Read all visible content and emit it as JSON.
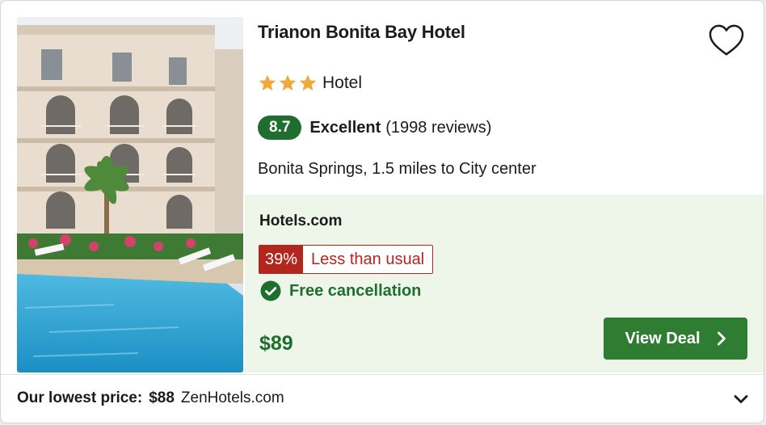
{
  "hotel": {
    "name": "Trianon Bonita Bay Hotel",
    "star_count": 3,
    "type_label": "Hotel",
    "score": "8.7",
    "rating_word": "Excellent",
    "reviews": "(1998 reviews)",
    "location": "Bonita Springs, 1.5 miles to City center"
  },
  "deal": {
    "provider": "Hotels.com",
    "discount_pct": "39%",
    "discount_label": "Less than usual",
    "cancellation": "Free cancellation",
    "price": "$89",
    "button_label": "View Deal"
  },
  "footer": {
    "lowest_label": "Our lowest price:",
    "lowest_price": "$88",
    "lowest_provider": "ZenHotels.com"
  },
  "colors": {
    "accent_green": "#2e7d32",
    "score_green": "#1e6f2f",
    "discount_red": "#b3261e",
    "star_gold": "#f0a93b",
    "deal_panel_bg": "#eef6ea"
  },
  "icons": {
    "favorite": "heart-outline-icon",
    "cancellation": "check-circle-icon",
    "button_arrow": "chevron-right-icon",
    "expand": "chevron-down-icon",
    "rating": "star-icon"
  }
}
